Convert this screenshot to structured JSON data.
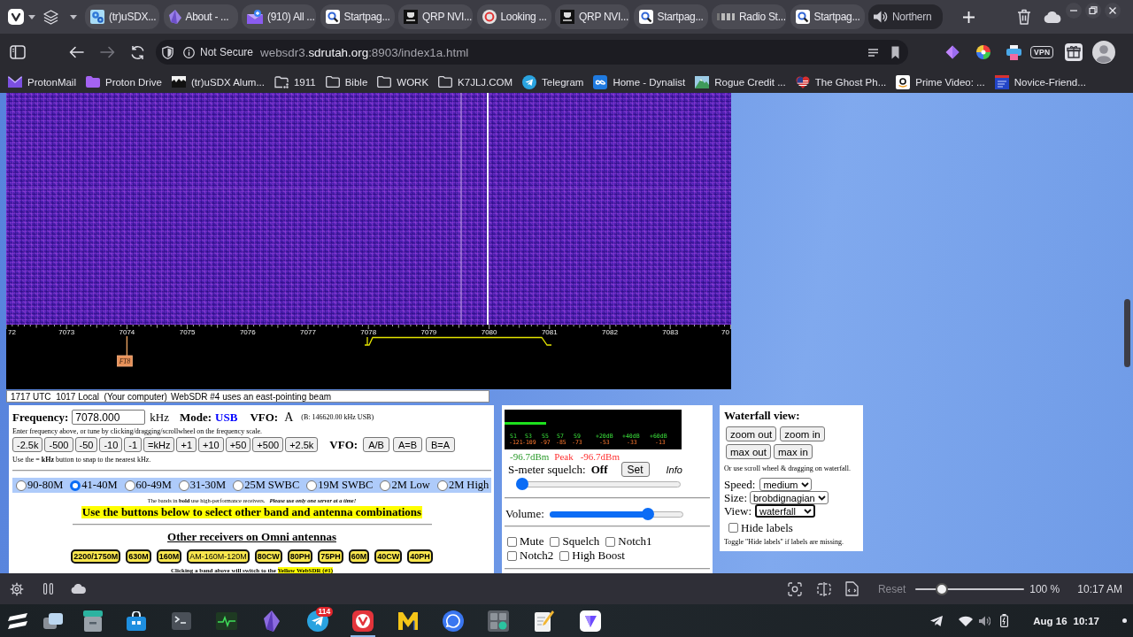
{
  "browser": {
    "tabs": [
      {
        "title": "(tr)uSDX...",
        "kind": "gears",
        "selected": false
      },
      {
        "title": "About - ...",
        "kind": "crystal",
        "selected": false
      },
      {
        "title": "(910) All ...",
        "kind": "envelope",
        "selected": false
      },
      {
        "title": "Startpag...",
        "kind": "magnifier",
        "selected": false
      },
      {
        "title": "QRP NVI...",
        "kind": "emblem",
        "selected": false
      },
      {
        "title": "Looking ...",
        "kind": "ring",
        "selected": false
      },
      {
        "title": "QRP NVI...",
        "kind": "emblem",
        "selected": false
      },
      {
        "title": "Startpag...",
        "kind": "magnifier",
        "selected": false
      },
      {
        "title": "Radio St...",
        "kind": "wordmark",
        "selected": false
      },
      {
        "title": "Startpag...",
        "kind": "magnifier",
        "selected": false
      },
      {
        "title": "Northern",
        "kind": "speaker",
        "selected": true
      }
    ],
    "security": "Not Secure",
    "url": "websdr3.**sdrutah.org**:8903/index1a.html",
    "vpn": "VPN",
    "bookmarks": [
      {
        "label": "ProtonMail",
        "kind": "mail"
      },
      {
        "label": "Proton Drive",
        "kind": "drive"
      },
      {
        "label": "(tr)uSDX Alum...",
        "kind": "photo"
      },
      {
        "label": "1911",
        "kind": "shared"
      },
      {
        "label": "Bible",
        "kind": "folder"
      },
      {
        "label": "WORK",
        "kind": "folder"
      },
      {
        "label": "K7JLJ.COM",
        "kind": "folder"
      },
      {
        "label": "Telegram",
        "kind": "plane"
      },
      {
        "label": "Home - Dynalist",
        "kind": "infinity"
      },
      {
        "label": "Rogue Credit ...",
        "kind": "mountain"
      },
      {
        "label": "The Ghost Ph...",
        "kind": "flag"
      },
      {
        "label": "Prime Video: ...",
        "kind": "smile"
      },
      {
        "label": "Novice-Friend...",
        "kind": "thumbnail"
      }
    ]
  },
  "waterfall": {
    "scale": [
      "72",
      "7073",
      "7074",
      "7075",
      "7076",
      "7077",
      "7078",
      "7079",
      "7080",
      "7081",
      "7082",
      "7083",
      "70"
    ],
    "markers": [
      {
        "label": "FT8"
      }
    ]
  },
  "status_line": {
    "clock": "1717 UTC  1017 Local  (Your computer)",
    "beam": "WebSDR #4 uses an east-pointing beam"
  },
  "tuning": {
    "frequency_label": "Frequency:",
    "frequency": "7078.000",
    "unit": "kHz",
    "mode_label": "Mode:",
    "mode": "USB",
    "vfo_label": "VFO:",
    "vfo": "A",
    "vfo_b": "(B: 146620.00 kHz USB)",
    "hint": "Enter frequency above, or tune by clicking/dragging/scrollwheel on the frequency scale.",
    "steps": [
      "-2.5k",
      "-500",
      "-50",
      "-10",
      "-1",
      "=kHz",
      "+1",
      "+10",
      "+50",
      "+500",
      "+2.5k"
    ],
    "vfo_buttons_label": "VFO:",
    "vfo_buttons": [
      "A/B",
      "A=B",
      "B=A"
    ],
    "snap_hint": "Use the **= kHz** button to snap to the nearest kHz.",
    "bands": [
      {
        "label": "90-80M",
        "selected": false
      },
      {
        "label": "41-40M",
        "selected": true
      },
      {
        "label": "60-49M",
        "selected": false
      },
      {
        "label": "31-30M",
        "selected": false
      },
      {
        "label": "25M SWBC",
        "selected": false
      },
      {
        "label": "19M SWBC",
        "selected": false
      },
      {
        "label": "2M Low",
        "selected": false
      },
      {
        "label": "2M High",
        "selected": false
      }
    ],
    "bands_note": "The bands in **bold** use high-performance receivers.",
    "bands_warning": "Please use only one server at a time!",
    "banner": "Use the buttons below to select other band and antenna combinations",
    "other_heading": "Other receivers on Omni antennas",
    "other_bands": [
      {
        "label": "2200/1750M",
        "bold": true
      },
      {
        "label": "630M",
        "bold": true
      },
      {
        "label": "160M",
        "bold": true
      },
      {
        "label": "AM-160M-120M",
        "bold": false
      },
      {
        "label": "80CW",
        "bold": true
      },
      {
        "label": "80PH",
        "bold": true
      },
      {
        "label": "75PH",
        "bold": true
      },
      {
        "label": "60M",
        "bold": true
      },
      {
        "label": "40CW",
        "bold": true
      },
      {
        "label": "40PH",
        "bold": true
      }
    ],
    "footer": "Clicking a band above will switch to the **Yellow WebSDR (#1)**"
  },
  "meter": {
    "level": 0.235,
    "s_labels": [
      "S1",
      "S3",
      "S5",
      "S7",
      "S9",
      "+20dB",
      "+40dB",
      "+60dB"
    ],
    "dbm_labels": [
      "-121",
      "-109",
      "-97",
      "-85",
      "-73",
      "-53",
      "-33",
      "-13"
    ],
    "reading": "-96.7dBm",
    "peak_label": "Peak",
    "peak": "-96.7dBm"
  },
  "squelch": {
    "label": "S-meter squelch:",
    "state": "Off",
    "button": "Set",
    "info": "Info",
    "level": 0
  },
  "volume": {
    "label": "Volume:",
    "level": 0.76
  },
  "options": [
    {
      "label": "Mute",
      "checked": false
    },
    {
      "label": "Squelch",
      "checked": false
    },
    {
      "label": "Notch1",
      "checked": false
    },
    {
      "label": "Notch2",
      "checked": false
    },
    {
      "label": "High Boost",
      "checked": false
    }
  ],
  "waterfall_view": {
    "title": "Waterfall view:",
    "buttons": [
      "zoom out",
      "zoom in",
      "max out",
      "max in"
    ],
    "hint": "Or use scroll wheel & dragging on waterfall.",
    "selects": [
      {
        "label": "Speed:",
        "value": "medium",
        "focused": false
      },
      {
        "label": "Size:",
        "value": "brobdignagian",
        "focused": false
      },
      {
        "label": "View:",
        "value": "waterfall",
        "focused": true
      }
    ],
    "hide_labels": {
      "label": "Hide labels",
      "checked": false
    },
    "toggle_hint": "Toggle \"Hide labels\" if labels are missing."
  },
  "status_bar": {
    "reset": "Reset",
    "level": 0.21,
    "zoom": "100 %",
    "clock": "10:17 AM"
  },
  "taskbar": {
    "apps": [
      {
        "kind": "launcher",
        "selected": false
      },
      {
        "kind": "windows",
        "selected": false
      },
      {
        "kind": "files",
        "selected": false
      },
      {
        "kind": "store",
        "selected": false
      },
      {
        "kind": "terminal",
        "selected": false
      },
      {
        "kind": "monitor",
        "selected": false
      },
      {
        "kind": "gem",
        "selected": false
      },
      {
        "kind": "messenger",
        "selected": false,
        "badge": "114"
      },
      {
        "kind": "browser",
        "selected": true
      },
      {
        "kind": "letter",
        "selected": false
      },
      {
        "kind": "chat",
        "selected": false
      },
      {
        "kind": "calculator",
        "selected": false
      },
      {
        "kind": "notes",
        "selected": false
      },
      {
        "kind": "shield",
        "selected": false
      }
    ],
    "date": "Aug 16",
    "time": "10:17"
  }
}
